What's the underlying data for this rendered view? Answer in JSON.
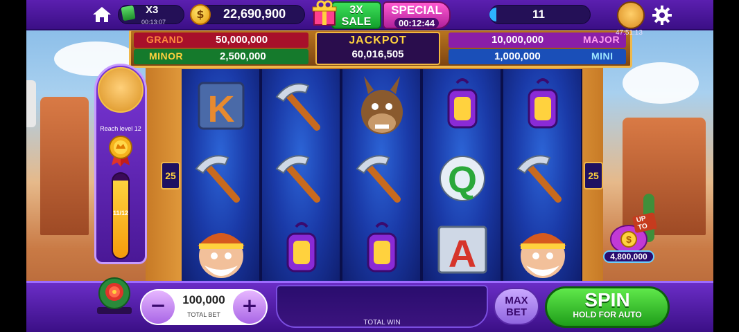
{
  "topbar": {
    "boost": {
      "multiplier": "X3",
      "timer": "00:13:07"
    },
    "coins": {
      "balance": "22,690,900"
    },
    "sale": {
      "line1": "3X",
      "line2": "SALE"
    },
    "special": {
      "title": "SPECIAL",
      "timer": "00:12:44"
    },
    "level": {
      "value": "11"
    },
    "avatar_timer": "47:51:13"
  },
  "jackpots": {
    "grand": {
      "label": "GRAND",
      "value": "50,000,000"
    },
    "minor": {
      "label": "MINOR",
      "value": "2,500,000"
    },
    "jackpot": {
      "label": "JACKPOT",
      "value": "60,016,505"
    },
    "major": {
      "label": "MAJOR",
      "value": "10,000,000"
    },
    "mini": {
      "label": "MINI",
      "value": "1,000,000"
    }
  },
  "paylines": {
    "left": "25",
    "right": "25"
  },
  "quest": {
    "text": "Reach level 12",
    "progress": "11/12",
    "fraction": 0.9167
  },
  "reels": [
    [
      "K",
      "pickaxe",
      "miner"
    ],
    [
      "pickaxe",
      "pickaxe",
      "lantern"
    ],
    [
      "donkey",
      "pickaxe",
      "lantern"
    ],
    [
      "lantern",
      "Q",
      "A"
    ],
    [
      "lantern",
      "pickaxe",
      "miner"
    ]
  ],
  "upto": {
    "label": "UP TO",
    "value": "4,800,000"
  },
  "bet": {
    "minus": "−",
    "plus": "+",
    "value": "100,000",
    "label": "TOTAL BET"
  },
  "win": {
    "label": "TOTAL WIN"
  },
  "maxbet": {
    "line1": "MAX",
    "line2": "BET"
  },
  "spin": {
    "label": "SPIN",
    "sub": "HOLD FOR AUTO"
  },
  "colors": {
    "accent_purple": "#5b1fb0",
    "spin_green": "#1f9e1a",
    "gold": "#f0b84a"
  }
}
